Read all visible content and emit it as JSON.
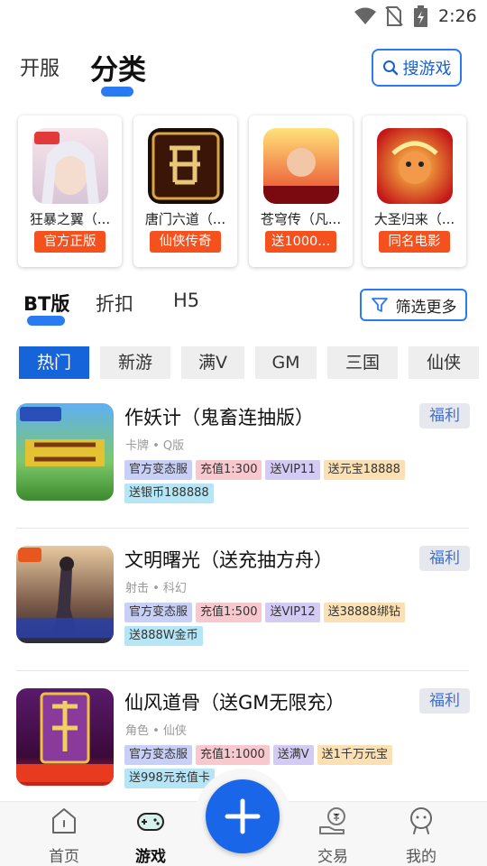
{
  "status_bar": {
    "time": "2:26",
    "icons": [
      "wifi-icon",
      "no-sim-icon",
      "battery-charging-icon"
    ]
  },
  "top_tabs": [
    {
      "label": "开服",
      "active": false
    },
    {
      "label": "分类",
      "active": true
    }
  ],
  "search_button": {
    "label": "搜游戏",
    "icon": "search-icon"
  },
  "featured": [
    {
      "name": "狂暴之翼（...",
      "tag": "官方正版"
    },
    {
      "name": "唐门六道（...",
      "tag": "仙侠传奇"
    },
    {
      "name": "苍穹传（凡...",
      "tag": "送1000..."
    },
    {
      "name": "大圣归来（...",
      "tag": "同名电影"
    }
  ],
  "sub_tabs": [
    {
      "label": "BT版",
      "active": true
    },
    {
      "label": "折扣",
      "active": false
    },
    {
      "label": "H5",
      "active": false
    }
  ],
  "filter_button": {
    "label": "筛选更多",
    "icon": "filter-icon"
  },
  "categories": [
    {
      "label": "热门",
      "active": true
    },
    {
      "label": "新游",
      "active": false
    },
    {
      "label": "满V",
      "active": false
    },
    {
      "label": "GM",
      "active": false
    },
    {
      "label": "三国",
      "active": false
    },
    {
      "label": "仙侠",
      "active": false
    }
  ],
  "games": [
    {
      "title": "作妖计（鬼畜连抽版）",
      "meta": "卡牌 • Q版",
      "badge": "福利",
      "tags": [
        "官方变态服",
        "充值1:300",
        "送VIP11",
        "送元宝18888",
        "送银币188888"
      ]
    },
    {
      "title": "文明曙光（送充抽方舟）",
      "meta": "射击 • 科幻",
      "badge": "福利",
      "tags": [
        "官方变态服",
        "充值1:500",
        "送VIP12",
        "送38888绑钻",
        "送888W金币"
      ]
    },
    {
      "title": "仙风道骨（送GM无限充）",
      "meta": "角色 • 仙侠",
      "badge": "福利",
      "tags": [
        "官方变态服",
        "充值1:1000",
        "送满V",
        "送1千万元宝",
        "送998元充值卡"
      ]
    }
  ],
  "bottom_nav": [
    {
      "label": "首页",
      "icon": "home-icon",
      "active": false
    },
    {
      "label": "游戏",
      "icon": "gamepad-icon",
      "active": true
    },
    {
      "label": "交易",
      "icon": "trade-icon",
      "active": false
    },
    {
      "label": "我的",
      "icon": "profile-icon",
      "active": false
    }
  ],
  "fab": {
    "icon": "plus-icon"
  },
  "colors": {
    "accent": "#2a7bf2",
    "chip_active": "#1664d9",
    "card_tag": "#f4511e",
    "badge_text": "#3a6fd8"
  }
}
